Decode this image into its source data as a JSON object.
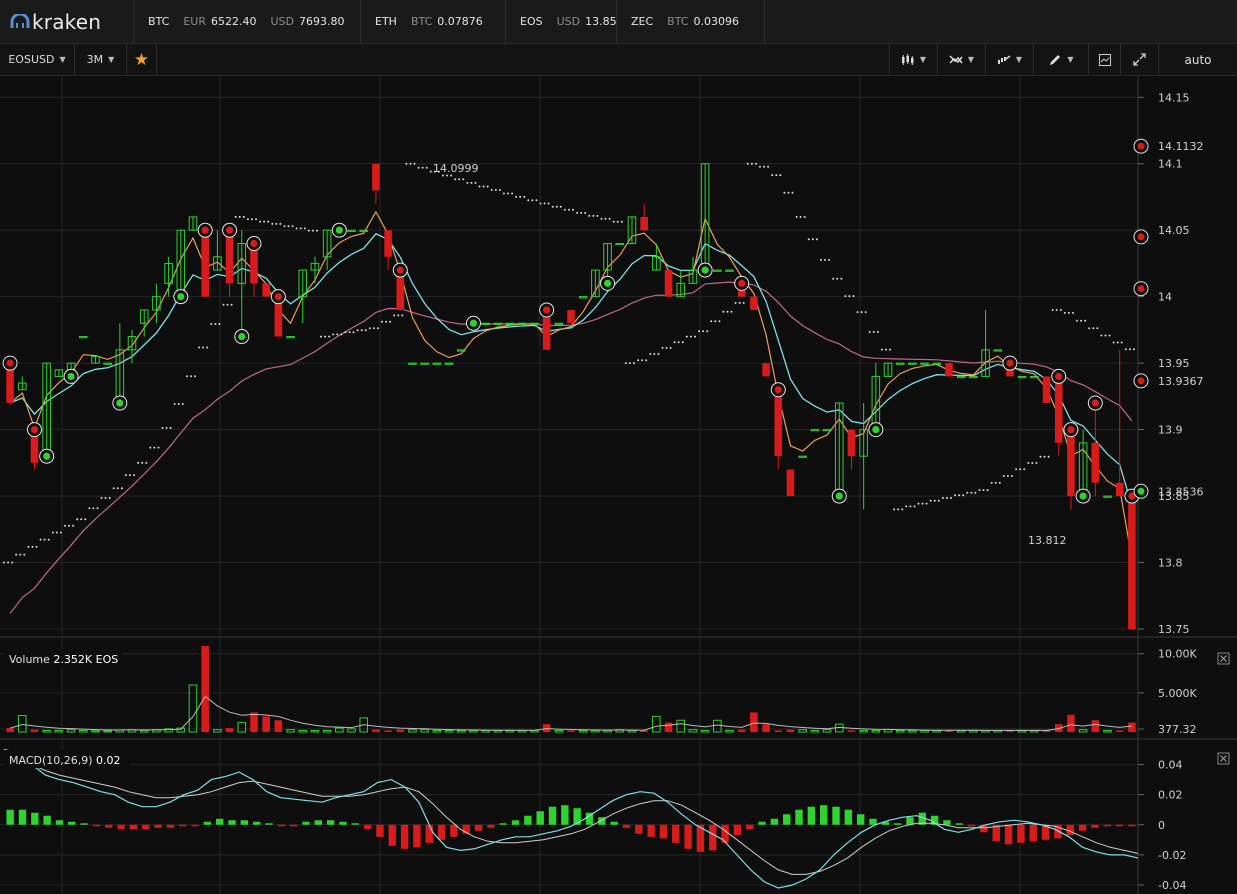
{
  "header": {
    "logo_text": "kraken",
    "tickers": [
      {
        "symbol": "BTC",
        "pairs": [
          {
            "cur": "EUR",
            "val": "6522.40"
          },
          {
            "cur": "USD",
            "val": "7693.80"
          }
        ]
      },
      {
        "symbol": "ETH",
        "pairs": [
          {
            "cur": "BTC",
            "val": "0.07876"
          }
        ]
      },
      {
        "symbol": "EOS",
        "pairs": [
          {
            "cur": "USD",
            "val": "13.85"
          }
        ]
      },
      {
        "symbol": "ZEC",
        "pairs": [
          {
            "cur": "BTC",
            "val": "0.03096"
          }
        ]
      }
    ]
  },
  "toolbar": {
    "pair": "EOSUSD",
    "interval": "3M",
    "favorite_icon": "star-icon",
    "tools": [
      "candle-type-icon",
      "indicators-icon",
      "compare-icon",
      "draw-icon",
      "screenshot-icon",
      "fullscreen-icon"
    ],
    "scale_mode": "auto"
  },
  "colors": {
    "up": "#2fd32f",
    "down": "#d81b1b",
    "ema_fast": "#e8a05a",
    "ema_slow": "#7fe0e8",
    "ma_long": "#c06a8a",
    "background": "#0e0e0e"
  },
  "price_panel": {
    "axis_ticks": [
      "14.15",
      "14.1",
      "14.05",
      "14",
      "13.95",
      "13.9",
      "13.85",
      "13.8",
      "13.75"
    ],
    "markers": [
      "14.1132",
      "14.0999",
      "13.9367",
      "13.8536",
      "13.812"
    ],
    "ylim": [
      13.747,
      14.166
    ]
  },
  "volume_panel": {
    "label": "Volume",
    "value": "2.352K EOS",
    "axis_ticks": [
      "10.00K",
      "5.000K",
      "377.32"
    ],
    "close_icon": "close-icon"
  },
  "macd_panel": {
    "label": "MACD(10,26,9)",
    "value": "0.02",
    "axis_ticks": [
      "0.04",
      "0.02",
      "0",
      "-0.02",
      "-0.04"
    ],
    "close_icon": "close-icon"
  },
  "chart_data": {
    "type": "candlestick",
    "candles": [
      [
        13.95,
        13.95,
        13.92,
        13.92
      ],
      [
        13.93,
        13.94,
        13.93,
        13.935
      ],
      [
        13.9,
        13.9,
        13.87,
        13.875
      ],
      [
        13.88,
        13.95,
        13.88,
        13.95
      ],
      [
        13.94,
        13.945,
        13.94,
        13.945
      ],
      [
        13.94,
        13.95,
        13.94,
        13.95
      ],
      [
        13.97,
        13.97,
        13.97,
        13.97
      ],
      [
        13.95,
        13.955,
        13.95,
        13.955
      ],
      [
        13.95,
        13.95,
        13.95,
        13.95
      ],
      [
        13.92,
        13.98,
        13.92,
        13.96
      ],
      [
        13.96,
        13.975,
        13.95,
        13.97
      ],
      [
        13.98,
        13.99,
        13.97,
        13.99
      ],
      [
        13.99,
        14.01,
        13.98,
        14.0
      ],
      [
        14.01,
        14.03,
        14.0,
        14.025
      ],
      [
        14.0,
        14.05,
        14.0,
        14.05
      ],
      [
        14.05,
        14.06,
        14.05,
        14.06
      ],
      [
        14.05,
        14.05,
        14.0,
        14.0
      ],
      [
        14.02,
        14.05,
        14.02,
        14.03
      ],
      [
        14.05,
        14.05,
        14.0,
        14.01
      ],
      [
        14.01,
        14.05,
        13.97,
        14.04
      ],
      [
        14.04,
        14.04,
        14.0,
        14.01
      ],
      [
        14.01,
        14.01,
        14.0,
        14.0
      ],
      [
        14.0,
        14.0,
        13.97,
        13.97
      ],
      [
        13.97,
        13.97,
        13.97,
        13.97
      ],
      [
        14.0,
        14.02,
        13.98,
        14.02
      ],
      [
        14.02,
        14.03,
        14.01,
        14.025
      ],
      [
        14.03,
        14.05,
        14.02,
        14.05
      ],
      [
        14.05,
        14.05,
        14.05,
        14.05
      ],
      [
        14.05,
        14.05,
        14.05,
        14.05
      ],
      [
        14.05,
        14.05,
        14.05,
        14.05
      ],
      [
        14.1,
        14.1,
        14.07,
        14.08
      ],
      [
        14.05,
        14.05,
        14.02,
        14.03
      ],
      [
        14.02,
        14.02,
        13.99,
        13.99
      ],
      [
        13.95,
        13.95,
        13.95,
        13.95
      ],
      [
        13.95,
        13.95,
        13.95,
        13.95
      ],
      [
        13.95,
        13.95,
        13.95,
        13.95
      ],
      [
        13.95,
        13.95,
        13.95,
        13.95
      ],
      [
        13.96,
        13.96,
        13.96,
        13.96
      ],
      [
        13.98,
        13.98,
        13.98,
        13.98
      ],
      [
        13.98,
        13.98,
        13.98,
        13.98
      ],
      [
        13.98,
        13.98,
        13.98,
        13.98
      ],
      [
        13.98,
        13.98,
        13.98,
        13.98
      ],
      [
        13.98,
        13.98,
        13.98,
        13.98
      ],
      [
        13.98,
        13.98,
        13.98,
        13.98
      ],
      [
        13.99,
        13.99,
        13.96,
        13.96
      ],
      [
        13.98,
        13.98,
        13.98,
        13.98
      ],
      [
        13.99,
        13.99,
        13.98,
        13.98
      ],
      [
        14.0,
        14.0,
        14.0,
        14.0
      ],
      [
        14.0,
        14.02,
        14.0,
        14.02
      ],
      [
        14.02,
        14.04,
        14.01,
        14.04
      ],
      [
        14.04,
        14.04,
        14.04,
        14.04
      ],
      [
        14.04,
        14.06,
        14.04,
        14.06
      ],
      [
        14.06,
        14.07,
        14.05,
        14.05
      ],
      [
        14.02,
        14.04,
        14.02,
        14.03
      ],
      [
        14.02,
        14.02,
        14.0,
        14.0
      ],
      [
        14.0,
        14.02,
        14.0,
        14.01
      ],
      [
        14.01,
        14.03,
        14.01,
        14.02
      ],
      [
        14.02,
        14.1,
        14.02,
        14.1
      ],
      [
        14.02,
        14.02,
        14.02,
        14.02
      ],
      [
        14.02,
        14.02,
        14.02,
        14.02
      ],
      [
        14.01,
        14.01,
        14.0,
        14.0
      ],
      [
        14.0,
        14.0,
        13.99,
        13.99
      ],
      [
        13.95,
        13.95,
        13.94,
        13.94
      ],
      [
        13.93,
        13.93,
        13.87,
        13.88
      ],
      [
        13.87,
        13.87,
        13.85,
        13.85
      ],
      [
        13.88,
        13.88,
        13.88,
        13.88
      ],
      [
        13.9,
        13.9,
        13.9,
        13.9
      ],
      [
        13.9,
        13.9,
        13.9,
        13.9
      ],
      [
        13.85,
        13.92,
        13.85,
        13.92
      ],
      [
        13.9,
        13.9,
        13.87,
        13.88
      ],
      [
        13.88,
        13.92,
        13.84,
        13.9
      ],
      [
        13.9,
        13.95,
        13.9,
        13.94
      ],
      [
        13.94,
        13.95,
        13.94,
        13.95
      ],
      [
        13.95,
        13.95,
        13.95,
        13.95
      ],
      [
        13.95,
        13.95,
        13.95,
        13.95
      ],
      [
        13.95,
        13.95,
        13.95,
        13.95
      ],
      [
        13.95,
        13.95,
        13.95,
        13.95
      ],
      [
        13.95,
        13.95,
        13.94,
        13.94
      ],
      [
        13.94,
        13.94,
        13.94,
        13.94
      ],
      [
        13.94,
        13.94,
        13.94,
        13.94
      ],
      [
        13.94,
        13.99,
        13.94,
        13.96
      ],
      [
        13.96,
        13.96,
        13.96,
        13.96
      ],
      [
        13.95,
        13.95,
        13.94,
        13.94
      ],
      [
        13.94,
        13.94,
        13.94,
        13.94
      ],
      [
        13.94,
        13.94,
        13.94,
        13.94
      ],
      [
        13.94,
        13.94,
        13.92,
        13.92
      ],
      [
        13.94,
        13.94,
        13.88,
        13.89
      ],
      [
        13.9,
        13.9,
        13.84,
        13.85
      ],
      [
        13.85,
        13.9,
        13.85,
        13.89
      ],
      [
        13.89,
        13.92,
        13.85,
        13.86
      ],
      [
        13.85,
        13.85,
        13.85,
        13.85
      ],
      [
        13.86,
        13.96,
        13.85,
        13.85
      ],
      [
        13.85,
        13.85,
        13.75,
        13.75
      ]
    ],
    "volume": [
      500,
      2100,
      300,
      200,
      200,
      300,
      200,
      150,
      150,
      250,
      300,
      200,
      300,
      400,
      500,
      6000,
      11000,
      300,
      500,
      1200,
      2500,
      2000,
      1500,
      300,
      200,
      200,
      200,
      500,
      400,
      1800,
      300,
      200,
      300,
      300,
      300,
      200,
      200,
      200,
      200,
      200,
      200,
      200,
      200,
      200,
      1000,
      200,
      200,
      200,
      200,
      200,
      300,
      200,
      200,
      2000,
      1200,
      1500,
      300,
      200,
      1500,
      200,
      300,
      2500,
      1000,
      200,
      300,
      300,
      200,
      300,
      1000,
      200,
      200,
      200,
      300,
      200,
      200,
      200,
      200,
      200,
      200,
      200,
      200,
      200,
      200,
      200,
      200,
      200,
      1000,
      2200,
      300,
      1500,
      200,
      200,
      1200,
      200
    ],
    "macd_hist": [
      0.01,
      0.01,
      0.008,
      0.006,
      0.003,
      0.002,
      0.001,
      -0.001,
      -0.002,
      -0.003,
      -0.003,
      -0.003,
      -0.002,
      -0.002,
      -0.001,
      -0.001,
      0.002,
      0.004,
      0.003,
      0.003,
      0.002,
      0.001,
      -0.001,
      -0.001,
      0.002,
      0.003,
      0.003,
      0.002,
      0.001,
      -0.003,
      -0.008,
      -0.014,
      -0.016,
      -0.015,
      -0.012,
      -0.01,
      -0.008,
      -0.006,
      -0.004,
      -0.002,
      0.001,
      0.003,
      0.006,
      0.009,
      0.012,
      0.013,
      0.011,
      0.008,
      0.005,
      0.002,
      -0.002,
      -0.006,
      -0.008,
      -0.009,
      -0.012,
      -0.016,
      -0.018,
      -0.017,
      -0.012,
      -0.007,
      -0.003,
      0.002,
      0.004,
      0.007,
      0.01,
      0.012,
      0.013,
      0.012,
      0.01,
      0.007,
      0.004,
      0.002,
      0.001,
      0.005,
      0.008,
      0.006,
      0.003,
      0.001,
      -0.001,
      -0.005,
      -0.011,
      -0.013,
      -0.012,
      -0.011,
      -0.01,
      -0.009,
      -0.007,
      -0.004,
      -0.002,
      -0.001,
      -0.001,
      -0.001
    ],
    "macd_line": [
      0.05,
      0.048,
      0.04,
      0.033,
      0.03,
      0.028,
      0.025,
      0.022,
      0.02,
      0.015,
      0.012,
      0.012,
      0.015,
      0.02,
      0.023,
      0.03,
      0.032,
      0.035,
      0.03,
      0.022,
      0.018,
      0.017,
      0.016,
      0.015,
      0.018,
      0.02,
      0.022,
      0.028,
      0.03,
      0.025,
      0.015,
      -0.005,
      -0.015,
      -0.017,
      -0.016,
      -0.013,
      -0.01,
      -0.008,
      -0.008,
      -0.006,
      -0.004,
      -0.001,
      0.004,
      0.01,
      0.016,
      0.02,
      0.022,
      0.021,
      0.015,
      0.007,
      0.0,
      -0.005,
      -0.01,
      -0.02,
      -0.03,
      -0.038,
      -0.042,
      -0.04,
      -0.036,
      -0.03,
      -0.02,
      -0.012,
      -0.005,
      0.0,
      0.003,
      0.005,
      0.006,
      0.003,
      -0.003,
      -0.005,
      -0.003,
      0.0,
      0.002,
      0.003,
      0.002,
      0.0,
      -0.003,
      -0.008,
      -0.015,
      -0.018,
      -0.02,
      -0.02,
      -0.022
    ],
    "signal_line": [
      0.045,
      0.044,
      0.04,
      0.036,
      0.033,
      0.031,
      0.029,
      0.027,
      0.025,
      0.022,
      0.02,
      0.018,
      0.018,
      0.019,
      0.02,
      0.022,
      0.025,
      0.028,
      0.029,
      0.027,
      0.025,
      0.023,
      0.021,
      0.019,
      0.019,
      0.019,
      0.02,
      0.022,
      0.024,
      0.025,
      0.022,
      0.014,
      0.005,
      -0.003,
      -0.008,
      -0.011,
      -0.012,
      -0.012,
      -0.011,
      -0.01,
      -0.008,
      -0.006,
      -0.003,
      0.002,
      0.007,
      0.011,
      0.014,
      0.016,
      0.016,
      0.013,
      0.008,
      0.003,
      -0.003,
      -0.01,
      -0.017,
      -0.024,
      -0.03,
      -0.033,
      -0.033,
      -0.031,
      -0.027,
      -0.022,
      -0.015,
      -0.009,
      -0.004,
      -0.001,
      0.001,
      0.001,
      0.0,
      -0.002,
      -0.002,
      -0.002,
      -0.001,
      0.0,
      0.001,
      0.0,
      -0.001,
      -0.004,
      -0.008,
      -0.012,
      -0.015,
      -0.017,
      -0.019
    ],
    "ylim_volume": [
      0,
      11500
    ],
    "ylim_macd": [
      -0.046,
      0.055
    ]
  }
}
